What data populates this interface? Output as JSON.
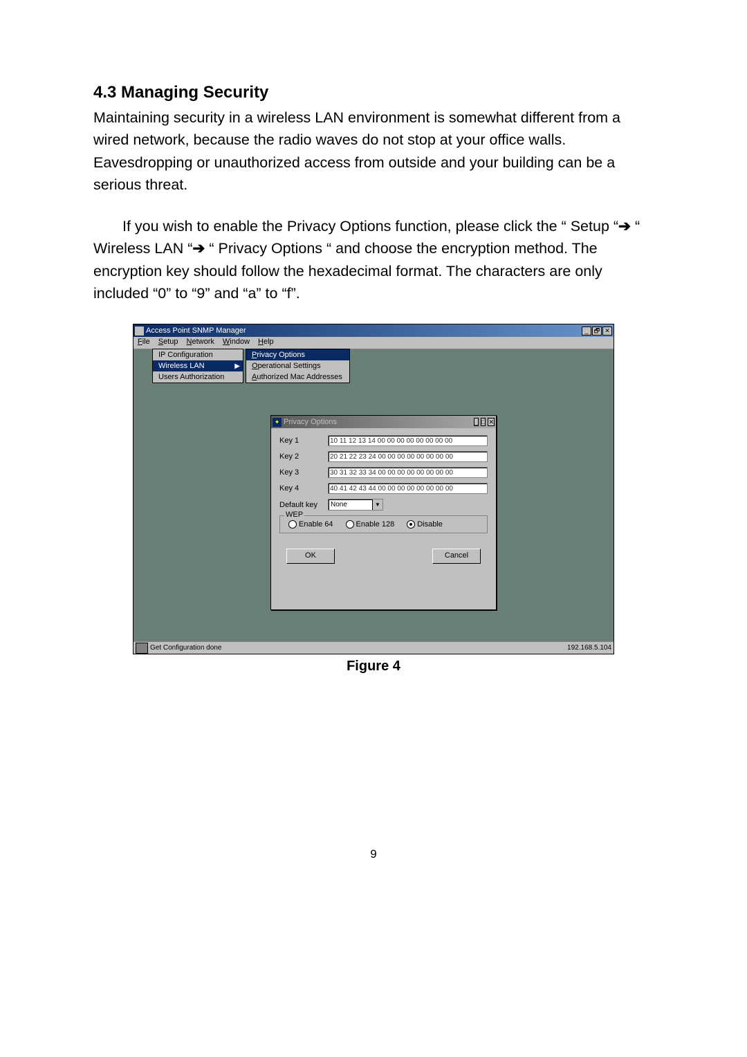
{
  "heading": "4.3 Managing Security",
  "paragraph1": "Maintaining security in a wireless LAN environment is somewhat different from a wired network, because the radio waves do not stop at your office walls. Eavesdropping or unauthorized access from outside and your building can be a serious threat.",
  "paragraph2_parts": {
    "p1": "If you wish to enable the Privacy Options function, please click the “ Setup “",
    "p2": " “ Wireless LAN “",
    "p3": " “ Privacy Options “ and choose the encryption method. The encryption key should follow the hexadecimal format. The characters are only included “0” to “9” and “a” to “f”."
  },
  "arrow": "➔",
  "figure_caption": "Figure 4",
  "page_number": "9",
  "snmp": {
    "title": "Access Point SNMP Manager",
    "menu": [
      "File",
      "Setup",
      "Network",
      "Window",
      "Help"
    ],
    "submenu1": [
      {
        "label": "IP Configuration",
        "hl": false
      },
      {
        "label": "Wireless LAN",
        "hl": true,
        "arrow": true
      },
      {
        "label": "Users Authorization",
        "hl": false
      }
    ],
    "submenu2": [
      {
        "label": "Privacy Options",
        "hl": true
      },
      {
        "label": "Operational Settings",
        "hl": false
      },
      {
        "label": "Authorized Mac Addresses",
        "hl": false
      }
    ],
    "dialog_title": "Privacy Options",
    "keys": [
      {
        "label": "Key 1",
        "value": "10 11 12 13 14 00 00 00 00 00 00 00 00"
      },
      {
        "label": "Key 2",
        "value": "20 21 22 23 24 00 00 00 00 00 00 00 00"
      },
      {
        "label": "Key 3",
        "value": "30 31 32 33 34 00 00 00 00 00 00 00 00"
      },
      {
        "label": "Key 4",
        "value": "40 41 42 43 44 00 00 00 00 00 00 00 00"
      }
    ],
    "default_key_label": "Default key",
    "default_key_value": "None",
    "wep_label": "WEP",
    "radios": [
      "Enable 64",
      "Enable 128",
      "Disable"
    ],
    "radio_selected": 2,
    "ok": "OK",
    "cancel": "Cancel",
    "status_left": "Get Configuration done",
    "status_right": "192.168.5.104"
  }
}
